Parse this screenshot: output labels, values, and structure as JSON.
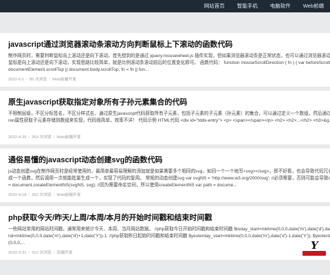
{
  "nav": {
    "items": [
      "网站首页",
      "智能手机",
      "电脑软件",
      "Web前端"
    ]
  },
  "articles": [
    {
      "title": "javascript通过浏览器滚动条滚动方向判断鼠标上下滚动的函数代码",
      "summary": "制作网页时，需要判断鼠标向上滚动还是向下滚动，首先想到的是通过 jquery.mousewheel.js 插件实现，但如果浏览器滚动条是正常状态，也可以通过浏览器滚动条滚动方向判断鼠标是向上滚动还是向下滚动，实现思路比较简单，就是比例滚动条滚动前后的位置变化即可。 函数代码： function mouseScrollDirection ( fn ) { var beforeScrollTop = document.documentElement.scrollTop || document.body.scrollTop, fn = fn || fun...",
      "date": "2022-6-1",
      "views": "85 次浏览",
      "category": "Web前端开发"
    },
    {
      "title": "原生javascript获取指定对象所有子孙元素集合的代码",
      "summary": "不限制层级，不区分标签名，不区分样式名，通过原生javascript代码获取所有子元素，包括子元素的子元素（孙元素）的集合，可以通过定义一个数组，然后通过 javascript的children属性获取子元素存储到数组来实现，代码很简单，效率不详！ 代码示例 HTML代码 <div id=\"tddx-entry\"> <p> <span></span></p> <h2> <h2>...</h2> <h3>&g...",
      "date": "2022-4-25",
      "views": "263 次浏览",
      "category": "Web前端开发"
    },
    {
      "title": "通俗易懂的javascript动态创建svg的函数代码",
      "summary": "js动态创建svg在制作网页时是经常使用的，最简单最容易理解的添加就是如果需要多个相同的svg，如同一个一个地写<svg></svg>，即不好看，也会导致代码冗长重复，如果封装成一个函数，然后调用一次就能批量生成一个，实现了代码的复用。 常规的动态创建svg var svgNS = 'http://www.w3.org/2000/svg'; //必须需要，否则可能会导致svg不显示 var svg = document.createElementNS(svgNS, svg); //因为需要命名空间，所以使用createElementNS var path = docume...",
      "date": "2022-4-18",
      "views": "252 次浏览",
      "category": "Web前端开发"
    },
    {
      "title": "php获取今天/昨天/上周/本周/本月的开始时间戳和结束时间戳",
      "summary": "一些网站常用的网站时间戳，通常用来统计今天、本周、当月网站数据。 //php获取今日开始时间戳和结束时间戳 $today_start=mktime(0,0,0,date('m'),date('d'),date('Y')); $today_end=mktime(0,0,0,date('m'),date('d')+1,date('Y'))-1; //php获取昨日起始时间戳和结束时间戳 $yesterday_start=mktime(0,0,0,date('m'),date('d')-1,date('Y')); $yesterday_end=mktime(0,0,0,...",
      "date": "2022-3-31",
      "views": "310 次浏览",
      "category": "后端开发"
    }
  ]
}
